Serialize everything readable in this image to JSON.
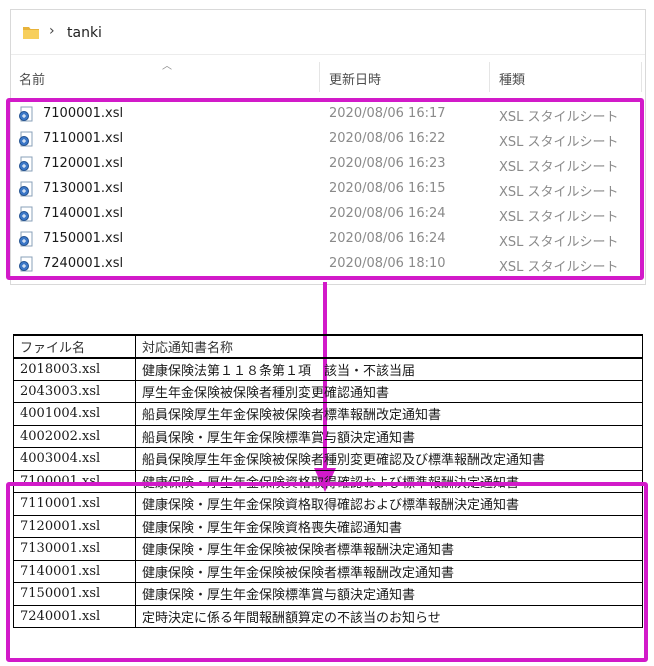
{
  "explorer": {
    "breadcrumb": "tanki",
    "columns": {
      "name": "名前",
      "date": "更新日時",
      "type": "種類"
    },
    "files": [
      {
        "name": "7100001.xsl",
        "date": "2020/08/06 16:17",
        "type": "XSL スタイルシート"
      },
      {
        "name": "7110001.xsl",
        "date": "2020/08/06 16:22",
        "type": "XSL スタイルシート"
      },
      {
        "name": "7120001.xsl",
        "date": "2020/08/06 16:23",
        "type": "XSL スタイルシート"
      },
      {
        "name": "7130001.xsl",
        "date": "2020/08/06 16:15",
        "type": "XSL スタイルシート"
      },
      {
        "name": "7140001.xsl",
        "date": "2020/08/06 16:24",
        "type": "XSL スタイルシート"
      },
      {
        "name": "7150001.xsl",
        "date": "2020/08/06 16:24",
        "type": "XSL スタイルシート"
      },
      {
        "name": "7240001.xsl",
        "date": "2020/08/06 18:10",
        "type": "XSL スタイルシート"
      }
    ]
  },
  "table": {
    "headers": [
      "ファイル名",
      "対応通知書名称"
    ],
    "rows": [
      [
        "2018003.xsl",
        "健康保険法第１１８条第１項　該当・不該当届"
      ],
      [
        "2043003.xsl",
        "厚生年金保険被保険者種別変更確認通知書"
      ],
      [
        "4001004.xsl",
        "船員保険厚生年金保険被保険者標準報酬改定通知書"
      ],
      [
        "4002002.xsl",
        "船員保険・厚生年金保険標準賞与額決定通知書"
      ],
      [
        "4003004.xsl",
        "船員保険厚生年金保険被保険者種別変更確認及び標準報酬改定通知書"
      ],
      [
        "7100001.xsl",
        "健康保険・厚生年金保険資格取得確認および標準報酬決定通知書"
      ],
      [
        "7110001.xsl",
        "健康保険・厚生年金保険資格取得確認および標準報酬決定通知書"
      ],
      [
        "7120001.xsl",
        "健康保険・厚生年金保険資格喪失確認通知書"
      ],
      [
        "7130001.xsl",
        "健康保険・厚生年金保険被保険者標準報酬決定通知書"
      ],
      [
        "7140001.xsl",
        "健康保険・厚生年金保険被保険者標準報酬改定通知書"
      ],
      [
        "7150001.xsl",
        "健康保険・厚生年金保険標準賞与額決定通知書"
      ],
      [
        "7240001.xsl",
        "定時決定に係る年間報酬額算定の不該当のお知らせ"
      ]
    ]
  },
  "colors": {
    "highlight": "#d21ac9",
    "folder": "#f2c14e"
  },
  "icons": {
    "folder": "folder-icon",
    "breadcrumb": "chevron-right-icon",
    "file": "xsl-file-icon",
    "arrow": "arrow-down-icon"
  }
}
